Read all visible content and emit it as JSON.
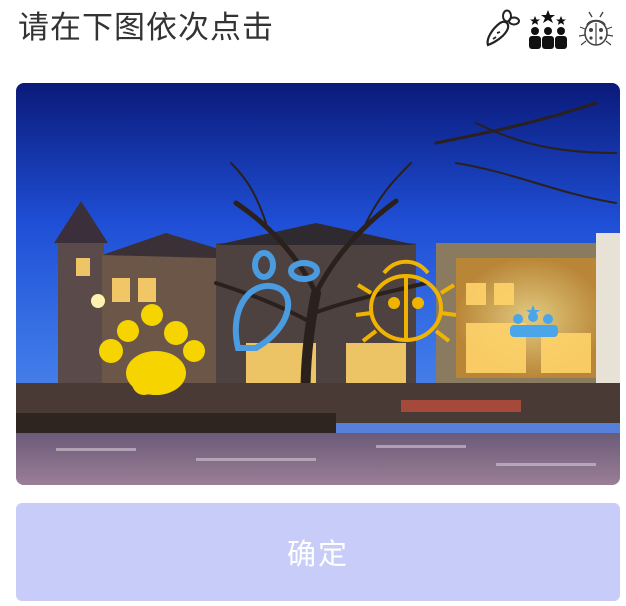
{
  "header": {
    "instruction": "请在下图依次点击",
    "targets": [
      "carrot-icon",
      "people-group-icon",
      "ladybug-icon"
    ]
  },
  "captcha": {
    "overlay_icons": [
      {
        "name": "paw-icon",
        "color": "#f5d400"
      },
      {
        "name": "carrot-icon",
        "color": "#4a9be0"
      },
      {
        "name": "ladybug-icon",
        "color": "#f0b400"
      },
      {
        "name": "people-group-icon",
        "color": "#4aa6e8"
      }
    ]
  },
  "button": {
    "confirm_label": "确定",
    "color": "#c7cdf8"
  }
}
